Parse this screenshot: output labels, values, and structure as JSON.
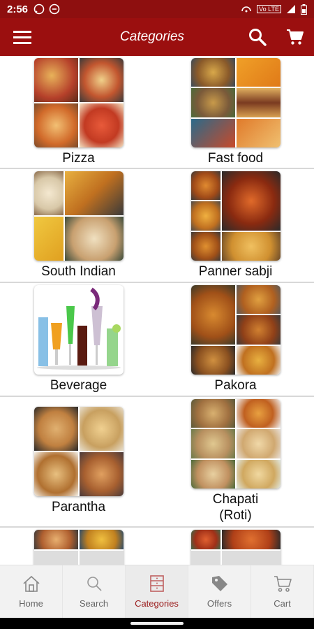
{
  "status": {
    "time": "2:56",
    "net": "Vo LTE"
  },
  "app_bar": {
    "title": "Categories"
  },
  "categories": [
    {
      "label": "Pizza"
    },
    {
      "label": "Fast food"
    },
    {
      "label": "South Indian"
    },
    {
      "label": "Panner sabji"
    },
    {
      "label": "Beverage"
    },
    {
      "label": "Pakora"
    },
    {
      "label": "Parantha"
    },
    {
      "label": "Chapati\n(Roti)"
    }
  ],
  "bottom_nav": [
    {
      "label": "Home",
      "icon": "home-icon"
    },
    {
      "label": "Search",
      "icon": "search-icon"
    },
    {
      "label": "Categories",
      "icon": "categories-icon",
      "active": true
    },
    {
      "label": "Offers",
      "icon": "tag-icon"
    },
    {
      "label": "Cart",
      "icon": "cart-icon"
    }
  ],
  "colors": {
    "primary": "#9b0f0f",
    "status_bar": "#8e0f0f",
    "active_nav": "#9b1c1c"
  }
}
